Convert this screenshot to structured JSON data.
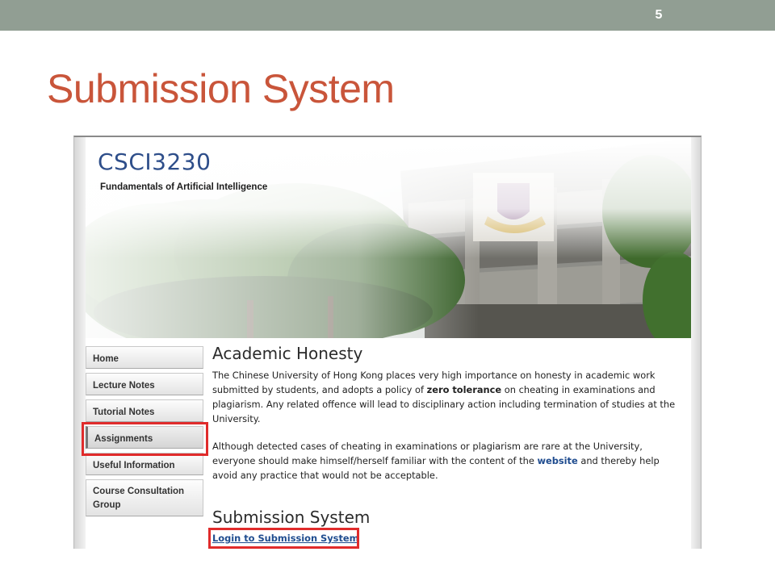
{
  "slide": {
    "number": "5",
    "title": "Submission System"
  },
  "site": {
    "course_code": "CSCI3230",
    "course_name": "Fundamentals of Artificial Intelligence"
  },
  "sidebar": {
    "items": [
      {
        "label": "Home"
      },
      {
        "label": "Lecture Notes"
      },
      {
        "label": "Tutorial Notes"
      },
      {
        "label": "Assignments"
      },
      {
        "label": "Useful Information"
      },
      {
        "label": "Course Consultation Group"
      }
    ]
  },
  "main": {
    "academic_heading": "Academic Honesty",
    "para1_before": "The Chinese University of Hong Kong places very high importance on honesty in academic work submitted by students, and adopts a policy of ",
    "para1_bold": "zero tolerance",
    "para1_after": " on cheating in examinations and plagiarism. Any related offence will lead to disciplinary action including termination of studies at the University.",
    "para2_before": "Although detected cases of cheating in examinations or plagiarism are rare at the University, everyone should make himself/herself familiar with the content of the ",
    "para2_link": "website",
    "para2_after": " and thereby help avoid any practice that would not be acceptable.",
    "submission_heading": "Submission System",
    "login_link": "Login to Submission System"
  },
  "colors": {
    "top_bar": "#919e93",
    "slide_title": "#c9553a",
    "course_code": "#2e4e8a",
    "link": "#1f4c8f",
    "highlight": "#e02b2b"
  }
}
